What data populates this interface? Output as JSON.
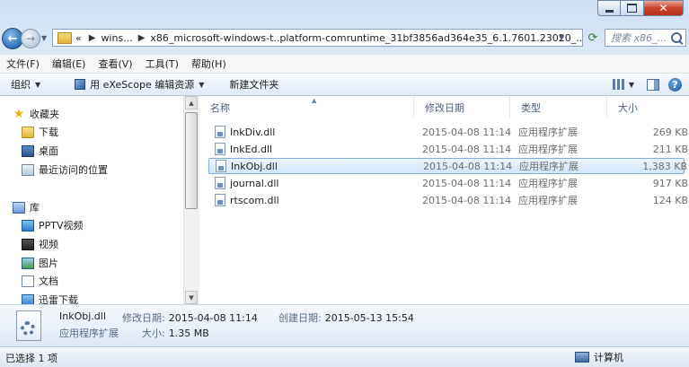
{
  "window": {
    "caption_close_glyph": "✕"
  },
  "nav": {
    "back_glyph": "←",
    "forward_glyph": "→",
    "address_segments": [
      "«",
      "wins...",
      "x86_microsoft-windows-t..platform-comruntime_31bf3856ad364e35_6.1.7601.23020_..."
    ],
    "search_placeholder": "搜索 x86_..."
  },
  "menubar": {
    "items": [
      "文件(F)",
      "编辑(E)",
      "查看(V)",
      "工具(T)",
      "帮助(H)"
    ]
  },
  "toolbar": {
    "organize": "组织",
    "open_with": "用 eXeScope 编辑资源",
    "new_folder": "新建文件夹",
    "help_glyph": "?"
  },
  "navpane": {
    "favorites_header": "收藏夹",
    "favorites": [
      "下载",
      "桌面",
      "最近访问的位置"
    ],
    "libraries_header": "库",
    "libraries": [
      "PPTV视频",
      "视频",
      "图片",
      "文档",
      "迅雷下载"
    ]
  },
  "filelist": {
    "columns": [
      "名称",
      "修改日期",
      "类型",
      "大小"
    ],
    "rows": [
      {
        "name": "InkDiv.dll",
        "date": "2015-04-08 11:14",
        "type": "应用程序扩展",
        "size": "269 KB",
        "selected": false
      },
      {
        "name": "InkEd.dll",
        "date": "2015-04-08 11:14",
        "type": "应用程序扩展",
        "size": "211 KB",
        "selected": false
      },
      {
        "name": "InkObj.dll",
        "date": "2015-04-08 11:14",
        "type": "应用程序扩展",
        "size": "1,383 KB",
        "selected": true
      },
      {
        "name": "journal.dll",
        "date": "2015-04-08 11:14",
        "type": "应用程序扩展",
        "size": "917 KB",
        "selected": false
      },
      {
        "name": "rtscom.dll",
        "date": "2015-04-08 11:14",
        "type": "应用程序扩展",
        "size": "124 KB",
        "selected": false
      }
    ]
  },
  "details": {
    "name": "InkObj.dll",
    "type": "应用程序扩展",
    "modified_label": "修改日期:",
    "modified_value": "2015-04-08 11:14",
    "created_label": "创建日期:",
    "created_value": "2015-05-13 15:54",
    "size_label": "大小:",
    "size_value": "1.35 MB"
  },
  "statusbar": {
    "selection": "已选择 1 项",
    "location": "计算机"
  }
}
